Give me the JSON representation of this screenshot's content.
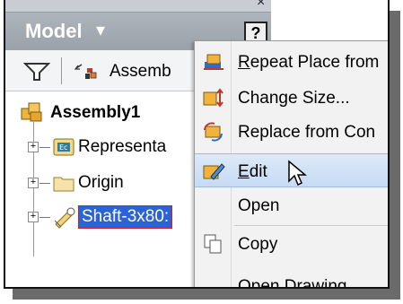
{
  "panel": {
    "title": "Model",
    "caret": "▾",
    "help_label": "?",
    "close_glyph": "×",
    "toolbar": {
      "assembly_label": "Assemb"
    }
  },
  "tree": [
    {
      "label": "Assembly1"
    },
    {
      "label": "Representa",
      "expand": "+"
    },
    {
      "label": "Origin",
      "expand": "+"
    },
    {
      "label": "Shaft-3x80:",
      "expand": "+"
    }
  ],
  "menu": {
    "items": [
      {
        "prefix": "R",
        "rest": "epeat Place from"
      },
      {
        "label": "Change Size..."
      },
      {
        "label": "Replace from Con"
      },
      {
        "prefix": "E",
        "rest": "dit"
      },
      {
        "label": "Open"
      },
      {
        "label": "Copy"
      },
      {
        "label": "Open Drawing"
      }
    ]
  },
  "icons": {
    "filter": "funnel-icon",
    "assembly": "assembly-icon",
    "part": "part-icon",
    "folder": "folder-icon",
    "edit": "pencil-icon"
  },
  "colors": {
    "panel_header": "#9aa1a8",
    "selection": "#2b62d6",
    "menu_highlight": "#c6dbf4"
  }
}
